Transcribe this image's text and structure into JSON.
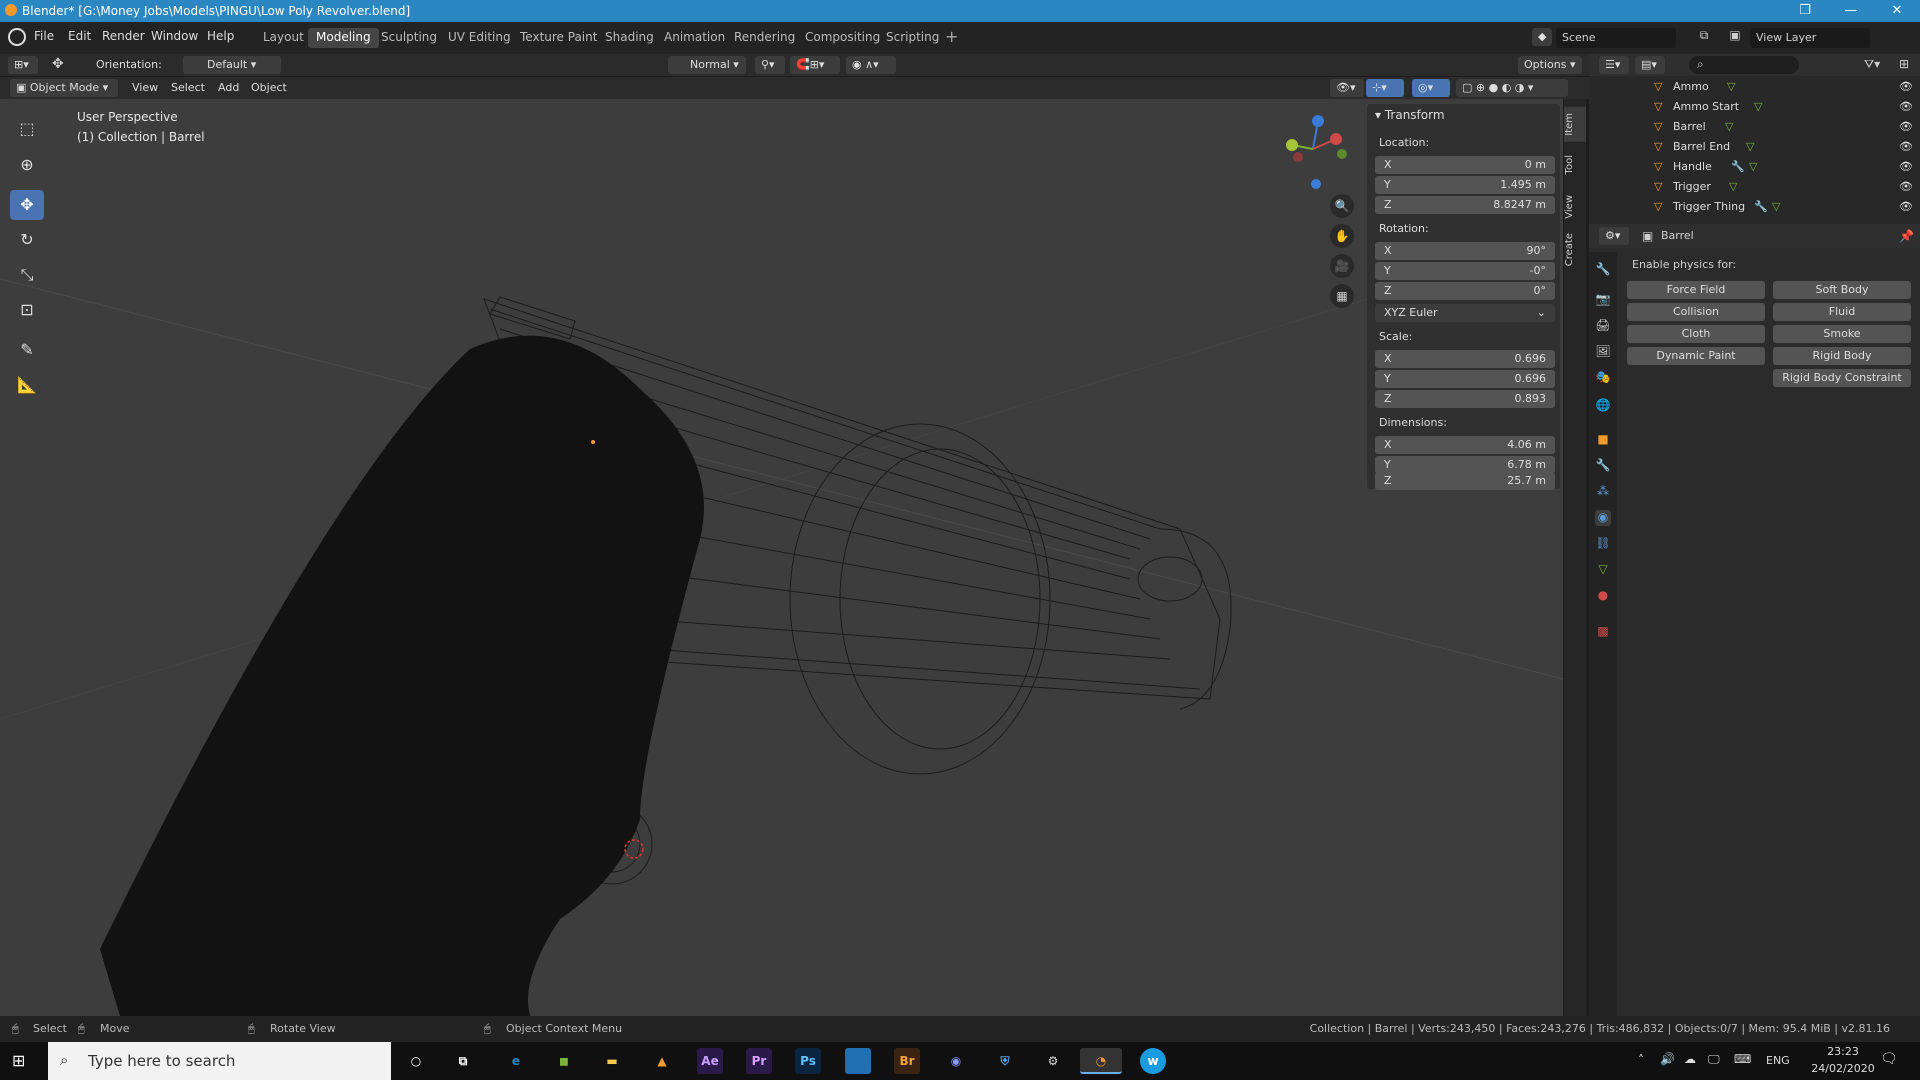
{
  "window": {
    "title": "Blender* [G:\\Money Jobs\\Models\\PINGU\\Low Poly Revolver.blend]"
  },
  "menu": [
    "File",
    "Edit",
    "Render",
    "Window",
    "Help"
  ],
  "workspaces": [
    "Layout",
    "Modeling",
    "Sculpting",
    "UV Editing",
    "Texture Paint",
    "Shading",
    "Animation",
    "Rendering",
    "Compositing",
    "Scripting"
  ],
  "active_workspace": "Modeling",
  "scene": {
    "label": "Scene",
    "view_layer": "View Layer"
  },
  "header": {
    "orientation_label": "Orientation:",
    "orientation_value": "Default",
    "pivot": "Normal",
    "options": "Options",
    "mode": "Object Mode",
    "view": "View",
    "select": "Select",
    "add": "Add",
    "object": "Object"
  },
  "viewport": {
    "perspective": "User Perspective",
    "collection": "(1) Collection | Barrel"
  },
  "transform": {
    "title": "Transform",
    "location_label": "Location:",
    "rotation_label": "Rotation:",
    "scale_label": "Scale:",
    "dimensions_label": "Dimensions:",
    "location": [
      {
        "axis": "X",
        "value": "0 m"
      },
      {
        "axis": "Y",
        "value": "1.495 m"
      },
      {
        "axis": "Z",
        "value": "8.8247 m"
      }
    ],
    "rotation": [
      {
        "axis": "X",
        "value": "90°"
      },
      {
        "axis": "Y",
        "value": "-0°"
      },
      {
        "axis": "Z",
        "value": "0°"
      }
    ],
    "rotation_mode": "XYZ Euler",
    "scale": [
      {
        "axis": "X",
        "value": "0.696"
      },
      {
        "axis": "Y",
        "value": "0.696"
      },
      {
        "axis": "Z",
        "value": "0.893"
      }
    ],
    "dimensions": [
      {
        "axis": "X",
        "value": "4.06 m"
      },
      {
        "axis": "Y",
        "value": "6.78 m"
      },
      {
        "axis": "Z",
        "value": "25.7 m"
      }
    ]
  },
  "side_tabs": [
    "Item",
    "Tool",
    "View",
    "Create"
  ],
  "outliner": [
    "Ammo",
    "Ammo Start",
    "Barrel",
    "Barrel End",
    "Handle",
    "Trigger",
    "Trigger Thing"
  ],
  "properties": {
    "object": "Barrel",
    "physics_label": "Enable physics for:",
    "buttons": [
      "Force Field",
      "Soft Body",
      "Collision",
      "Fluid",
      "Cloth",
      "Smoke",
      "Dynamic Paint",
      "Rigid Body",
      "Rigid Body Constraint"
    ]
  },
  "status": {
    "select": "Select",
    "move": "Move",
    "rotate": "Rotate View",
    "context": "Object Context Menu",
    "stats": "Collection | Barrel | Verts:243,450 | Faces:243,276 | Tris:486,832 | Objects:0/7 | Mem: 95.4 MiB | v2.81.16"
  },
  "taskbar": {
    "search": "Type here to search",
    "lang": "ENG",
    "time": "23:23",
    "date": "24/02/2020",
    "apps": [
      "Ae",
      "Pr",
      "Ps",
      "Br"
    ]
  },
  "colors": {
    "accent": "#4a73b2",
    "titlebar": "#2b87c2",
    "orange": "#f39a2c"
  }
}
